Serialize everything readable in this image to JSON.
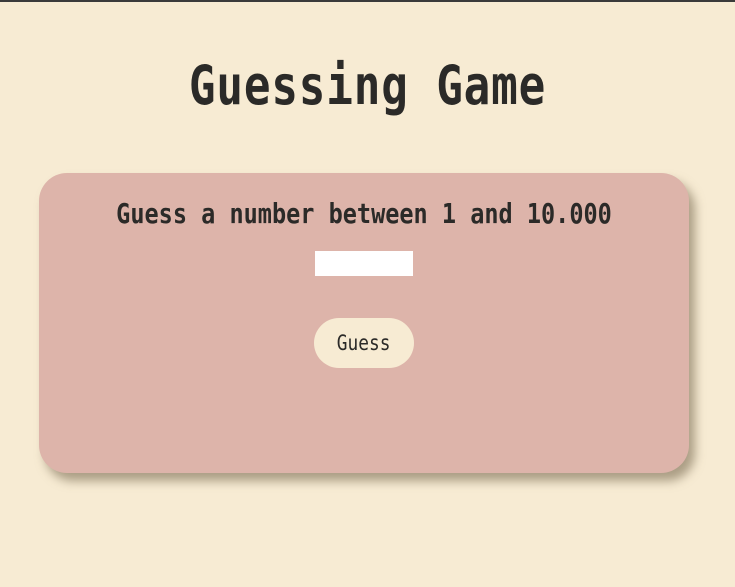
{
  "page": {
    "title": "Guessing Game"
  },
  "card": {
    "prompt": "Guess a number between 1 and 10.000",
    "input_value": "",
    "button_label": "Guess"
  },
  "colors": {
    "background": "#f7ebd3",
    "card": "#ddb4aa",
    "button": "#f7ebd3",
    "text": "#2b2a28",
    "input": "#ffffff"
  }
}
